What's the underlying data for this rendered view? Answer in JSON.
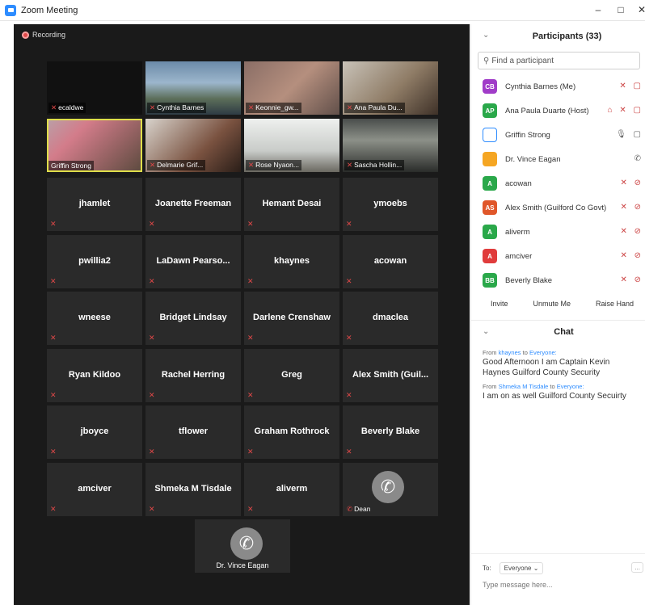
{
  "window": {
    "title": "Zoom Meeting",
    "minimize": "–",
    "maximize": "□",
    "close": "✕"
  },
  "video": {
    "recording_label": "Recording",
    "photo_tiles": [
      {
        "name": "ecaldwe",
        "style": "ph0"
      },
      {
        "name": "Cynthia Barnes",
        "style": "ph1"
      },
      {
        "name": "Keonnie_gw...",
        "style": "ph2"
      },
      {
        "name": "Ana Paula Du...",
        "style": "ph3"
      },
      {
        "name": "Griffin Strong",
        "style": "ph4"
      },
      {
        "name": "Delmarie Grif...",
        "style": "ph5"
      },
      {
        "name": "Rose Nyaon...",
        "style": "ph6"
      },
      {
        "name": "Sascha Hollin...",
        "style": "ph7"
      }
    ],
    "name_tiles": [
      "jhamlet",
      "Joanette Freeman",
      "Hemant Desai",
      "ymoebs",
      "pwillia2",
      "LaDawn  Pearso...",
      "khaynes",
      "acowan",
      "wneese",
      "Bridget Lindsay",
      "Darlene Crenshaw",
      "dmaclea",
      "Ryan Kildoo",
      "Rachel Herring",
      "Greg",
      "Alex Smith (Guil...",
      "jboyce",
      "tflower",
      "Graham Rothrock",
      "Beverly Blake",
      "amciver",
      "Shmeka M Tisdale",
      "aliverm"
    ],
    "phone_tile_name": "Dean",
    "bottom_tile_name": "Dr. Vince Eagan"
  },
  "participants": {
    "title": "Participants (33)",
    "search_placeholder": "Find a participant",
    "list": [
      {
        "initials": "CB",
        "name": "Cynthia Barnes (Me)",
        "color": "#a03cc8",
        "icons": "✕ ▢"
      },
      {
        "initials": "AP",
        "name": "Ana Paula Duarte (Host)",
        "color": "#2aa84a",
        "icons": "⌂ ✕ ▢"
      },
      {
        "initials": "",
        "name": "Griffin Strong",
        "color": "#ffffff",
        "icons": "🎙 ▢"
      },
      {
        "initials": "",
        "name": "Dr. Vince Eagan",
        "color": "#f5a623",
        "icons": "✆"
      },
      {
        "initials": "A",
        "name": "acowan",
        "color": "#2aa84a",
        "icons": "✕ ⊘"
      },
      {
        "initials": "AS",
        "name": "Alex Smith (Guilford Co Govt)",
        "color": "#e0572a",
        "icons": "✕ ⊘"
      },
      {
        "initials": "A",
        "name": "aliverm",
        "color": "#2aa84a",
        "icons": "✕ ⊘"
      },
      {
        "initials": "A",
        "name": "amciver",
        "color": "#e03c3c",
        "icons": "✕ ⊘"
      },
      {
        "initials": "BB",
        "name": "Beverly Blake",
        "color": "#2aa84a",
        "icons": "✕ ⊘"
      }
    ],
    "invite_label": "Invite",
    "unmute_label": "Unmute Me",
    "raise_hand_label": "Raise Hand"
  },
  "chat": {
    "title": "Chat",
    "messages": [
      {
        "from_prefix": "From",
        "from": "khaynes",
        "to_prefix": "to",
        "to": "Everyone:",
        "text": "Good Afternoon I am Captain Kevin Haynes Guilford County Security"
      },
      {
        "from_prefix": "From",
        "from": "Shmeka M Tisdale",
        "to_prefix": "to",
        "to": "Everyone:",
        "text": "I am on as well Guilford County Secuirty"
      }
    ],
    "to_label": "To:",
    "to_value": "Everyone",
    "more_label": "...",
    "input_placeholder": "Type message here..."
  }
}
